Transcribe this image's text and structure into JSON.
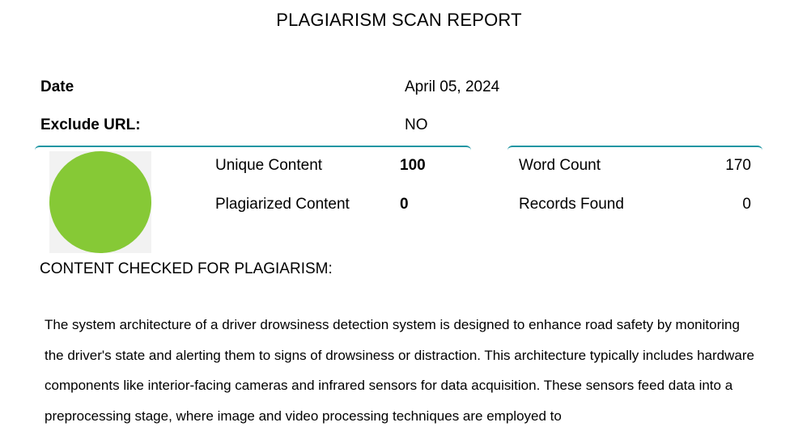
{
  "report": {
    "title": "PLAGIARISM SCAN REPORT"
  },
  "meta": {
    "date_label": "Date",
    "date_value": "April 05, 2024",
    "exclude_url_label": "Exclude URL:",
    "exclude_url_value": "NO"
  },
  "colors": {
    "panel_rule": "#1f96a3",
    "chart_fill": "#86c936",
    "chart_bg": "#f2f2f2"
  },
  "stats": {
    "unique_label": "Unique Content",
    "unique_value": "100",
    "plagiarized_label": "Plagiarized Content",
    "plagiarized_value": "0",
    "word_count_label": "Word Count",
    "word_count_value": "170",
    "records_label": "Records Found",
    "records_value": "0"
  },
  "chart_data": {
    "type": "pie",
    "categories": [
      "Unique Content",
      "Plagiarized Content"
    ],
    "values": [
      100,
      0
    ]
  },
  "content": {
    "heading": "CONTENT CHECKED FOR PLAGIARISM:",
    "text": "The system architecture of a driver drowsiness detection system is designed to enhance road safety by monitoring the driver's state and alerting them to signs of drowsiness or distraction. This architecture typically includes hardware components like interior-facing cameras and infrared sensors for data acquisition. These sensors feed data into a preprocessing stage, where image and video processing techniques are employed to"
  }
}
